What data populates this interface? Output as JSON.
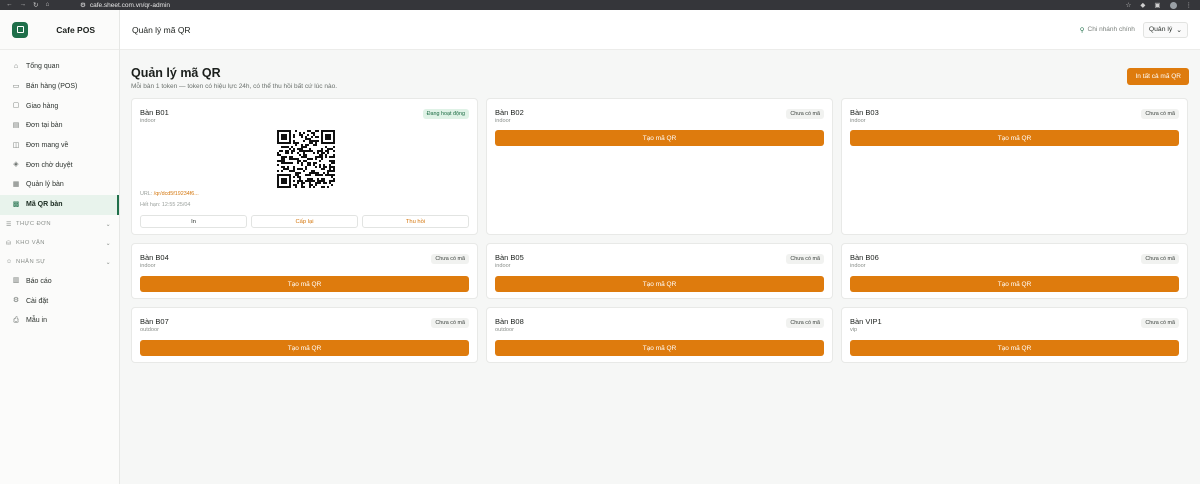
{
  "browser": {
    "url": "cafe.sheet.com.vn/qr-admin"
  },
  "sidebar": {
    "brand": "Cafe POS",
    "items": [
      {
        "label": "Tổng quan",
        "icon": "home-icon"
      },
      {
        "label": "Bán hàng (POS)",
        "icon": "cart-icon"
      },
      {
        "label": "Giao hàng",
        "icon": "box-icon"
      },
      {
        "label": "Đơn tại bàn",
        "icon": "clipboard-icon"
      },
      {
        "label": "Đơn mang về",
        "icon": "bag-icon"
      },
      {
        "label": "Đơn chờ duyệt",
        "icon": "shield-check-icon"
      },
      {
        "label": "Quản lý bàn",
        "icon": "table-icon"
      },
      {
        "label": "Mã QR bàn",
        "icon": "qr-icon",
        "active": true
      }
    ],
    "sections": [
      {
        "label": "THỰC ĐƠN"
      },
      {
        "label": "KHO VẬN"
      },
      {
        "label": "NHÂN SỰ"
      }
    ],
    "bottom_items": [
      {
        "label": "Báo cáo",
        "icon": "chart-icon"
      },
      {
        "label": "Cài đặt",
        "icon": "gear-icon"
      },
      {
        "label": "Mẫu in",
        "icon": "printer-icon"
      }
    ]
  },
  "topbar": {
    "title": "Quản lý mã QR",
    "branch": "Chi nhánh chính",
    "role": "Quản lý"
  },
  "page": {
    "title": "Quản lý mã QR",
    "subtitle": "Mỗi bàn 1 token — token có hiệu lực 24h, có thể thu hồi bất cứ lúc nào.",
    "print_all": "In tất cả mã QR"
  },
  "tables": [
    {
      "name": "Bàn B01",
      "area": "indoor",
      "status": "Đang hoạt động",
      "active": true,
      "url_label": "URL:",
      "url": "/qr/dcd5f19234f6...",
      "expiry": "Hết hạn: 12:55 25/04",
      "actions": {
        "print": "In",
        "reissue": "Cấp lại",
        "revoke": "Thu hồi"
      }
    },
    {
      "name": "Bàn B02",
      "area": "indoor",
      "status": "Chưa có mã",
      "button": "Tạo mã QR"
    },
    {
      "name": "Bàn B03",
      "area": "indoor",
      "status": "Chưa có mã",
      "button": "Tạo mã QR"
    },
    {
      "name": "Bàn B04",
      "area": "indoor",
      "status": "Chưa có mã",
      "button": "Tạo mã QR"
    },
    {
      "name": "Bàn B05",
      "area": "indoor",
      "status": "Chưa có mã",
      "button": "Tạo mã QR"
    },
    {
      "name": "Bàn B06",
      "area": "indoor",
      "status": "Chưa có mã",
      "button": "Tạo mã QR"
    },
    {
      "name": "Bàn B07",
      "area": "outdoor",
      "status": "Chưa có mã",
      "button": "Tạo mã QR"
    },
    {
      "name": "Bàn B08",
      "area": "outdoor",
      "status": "Chưa có mã",
      "button": "Tạo mã QR"
    },
    {
      "name": "Bàn VIP1",
      "area": "vip",
      "status": "Chưa có mã",
      "button": "Tạo mã QR"
    }
  ],
  "colors": {
    "accent": "#de7b0d",
    "brand": "#1f6f4a",
    "active_badge": "#dff2e6"
  }
}
